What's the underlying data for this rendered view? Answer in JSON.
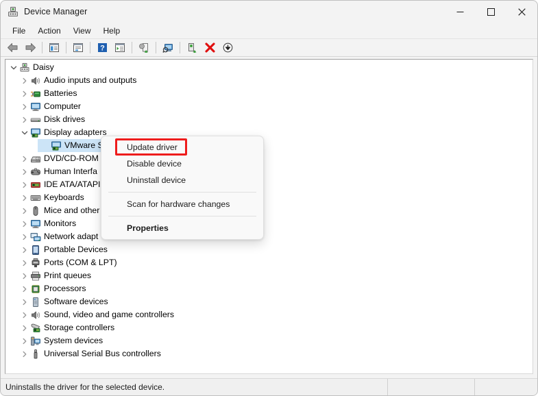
{
  "window": {
    "title": "Device Manager",
    "icon": "device-manager-icon",
    "controls": [
      {
        "name": "minimize-button",
        "glyph": "—"
      },
      {
        "name": "maximize-button",
        "glyph": "□"
      },
      {
        "name": "close-button",
        "glyph": "✕"
      }
    ]
  },
  "menubar": {
    "items": [
      {
        "label": "File"
      },
      {
        "label": "Action"
      },
      {
        "label": "View"
      },
      {
        "label": "Help"
      }
    ]
  },
  "toolbar": {
    "buttons": [
      {
        "name": "back-icon"
      },
      {
        "name": "forward-icon"
      },
      {
        "name": "separator"
      },
      {
        "name": "show-hide-console-tree-icon"
      },
      {
        "name": "separator"
      },
      {
        "name": "properties-icon"
      },
      {
        "name": "separator"
      },
      {
        "name": "help-icon"
      },
      {
        "name": "show-hide-action-pane-icon"
      },
      {
        "name": "separator"
      },
      {
        "name": "update-driver-icon"
      },
      {
        "name": "separator"
      },
      {
        "name": "scan-for-hardware-changes-icon"
      },
      {
        "name": "separator"
      },
      {
        "name": "enable-device-icon"
      },
      {
        "name": "uninstall-device-icon"
      },
      {
        "name": "disable-device-icon"
      }
    ]
  },
  "tree": {
    "nodes": [
      {
        "label": "Daisy",
        "depth": 0,
        "expander": "expanded",
        "icon": "computer-device-icon",
        "selected": false
      },
      {
        "label": "Audio inputs and outputs",
        "depth": 1,
        "expander": "collapsed",
        "icon": "speaker-icon",
        "selected": false
      },
      {
        "label": "Batteries",
        "depth": 1,
        "expander": "collapsed",
        "icon": "battery-icon",
        "selected": false
      },
      {
        "label": "Computer",
        "depth": 1,
        "expander": "collapsed",
        "icon": "monitor-icon",
        "selected": false
      },
      {
        "label": "Disk drives",
        "depth": 1,
        "expander": "collapsed",
        "icon": "disk-drive-icon",
        "selected": false
      },
      {
        "label": "Display adapters",
        "depth": 1,
        "expander": "expanded",
        "icon": "display-adapter-icon",
        "selected": false
      },
      {
        "label": "VMware SV",
        "depth": 2,
        "expander": "none",
        "icon": "display-adapter-icon",
        "selected": true
      },
      {
        "label": "DVD/CD-ROM",
        "depth": 1,
        "expander": "collapsed",
        "icon": "dvd-drive-icon",
        "selected": false
      },
      {
        "label": "Human Interfa",
        "depth": 1,
        "expander": "collapsed",
        "icon": "gamepad-icon",
        "selected": false
      },
      {
        "label": "IDE ATA/ATAPI",
        "depth": 1,
        "expander": "collapsed",
        "icon": "ide-controller-icon",
        "selected": false
      },
      {
        "label": "Keyboards",
        "depth": 1,
        "expander": "collapsed",
        "icon": "keyboard-icon",
        "selected": false
      },
      {
        "label": "Mice and other",
        "depth": 1,
        "expander": "collapsed",
        "icon": "mouse-icon",
        "selected": false
      },
      {
        "label": "Monitors",
        "depth": 1,
        "expander": "collapsed",
        "icon": "monitor-icon",
        "selected": false
      },
      {
        "label": "Network adapt",
        "depth": 1,
        "expander": "collapsed",
        "icon": "network-adapter-icon",
        "selected": false
      },
      {
        "label": "Portable Devices",
        "depth": 1,
        "expander": "collapsed",
        "icon": "portable-device-icon",
        "selected": false
      },
      {
        "label": "Ports (COM & LPT)",
        "depth": 1,
        "expander": "collapsed",
        "icon": "port-icon",
        "selected": false
      },
      {
        "label": "Print queues",
        "depth": 1,
        "expander": "collapsed",
        "icon": "printer-icon",
        "selected": false
      },
      {
        "label": "Processors",
        "depth": 1,
        "expander": "collapsed",
        "icon": "processor-icon",
        "selected": false
      },
      {
        "label": "Software devices",
        "depth": 1,
        "expander": "collapsed",
        "icon": "software-device-icon",
        "selected": false
      },
      {
        "label": "Sound, video and game controllers",
        "depth": 1,
        "expander": "collapsed",
        "icon": "speaker-icon",
        "selected": false
      },
      {
        "label": "Storage controllers",
        "depth": 1,
        "expander": "collapsed",
        "icon": "storage-controller-icon",
        "selected": false
      },
      {
        "label": "System devices",
        "depth": 1,
        "expander": "collapsed",
        "icon": "system-device-icon",
        "selected": false
      },
      {
        "label": "Universal Serial Bus controllers",
        "depth": 1,
        "expander": "collapsed",
        "icon": "usb-icon",
        "selected": false
      }
    ]
  },
  "context_menu": {
    "items": [
      {
        "type": "item",
        "label": "Update driver",
        "bold": false,
        "highlighted": true
      },
      {
        "type": "item",
        "label": "Disable device",
        "bold": false,
        "highlighted": false
      },
      {
        "type": "item",
        "label": "Uninstall device",
        "bold": false,
        "highlighted": false
      },
      {
        "type": "separator"
      },
      {
        "type": "item",
        "label": "Scan for hardware changes",
        "bold": false,
        "highlighted": false
      },
      {
        "type": "separator"
      },
      {
        "type": "item",
        "label": "Properties",
        "bold": true,
        "highlighted": false
      }
    ],
    "highlight_color": "#ee1c1c"
  },
  "statusbar": {
    "message": "Uninstalls the driver for the selected device."
  },
  "colors": {
    "selection": "#cce4f7",
    "window_bg": "#f3f3f3",
    "panel_bg": "#ffffff",
    "accent_red": "#ee1c1c"
  }
}
